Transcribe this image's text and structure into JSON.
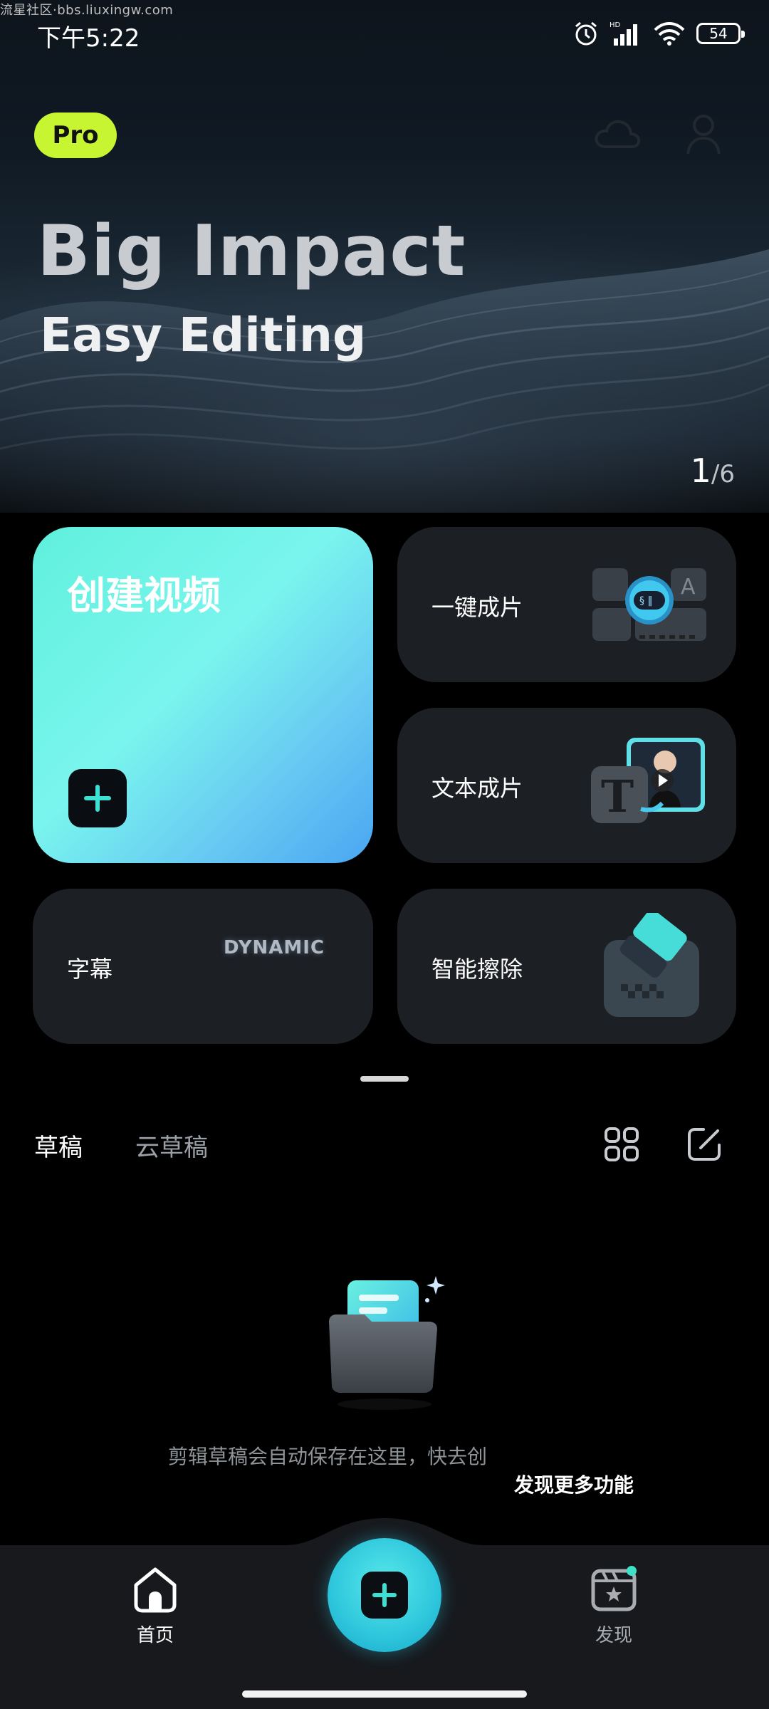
{
  "watermark": "流星社区·bbs.liuxingw.com",
  "status_bar": {
    "time": "下午5:22",
    "battery": "54",
    "network": "HD"
  },
  "header": {
    "pro_badge": "Pro"
  },
  "hero": {
    "headline": "Big Impact",
    "subheadline": "Easy Editing",
    "pager_current": "1",
    "pager_separator": "/",
    "pager_total": "6"
  },
  "cards": {
    "create": "创建视频",
    "one_key": "一键成片",
    "text_to_video": "文本成片",
    "subtitle": "字幕",
    "subtitle_art": "DYNAMIC",
    "smart_erase": "智能擦除"
  },
  "drafts": {
    "tabs": [
      "草稿",
      "云草稿"
    ],
    "empty_text": "剪辑草稿会自动保存在这里，快去创",
    "tooltip": "发现更多功能"
  },
  "bottom_nav": {
    "home": "首页",
    "discover": "发现"
  },
  "colors": {
    "pro": "#c8f531",
    "accent": "#2ec6dc",
    "card": "#1c1f24"
  }
}
